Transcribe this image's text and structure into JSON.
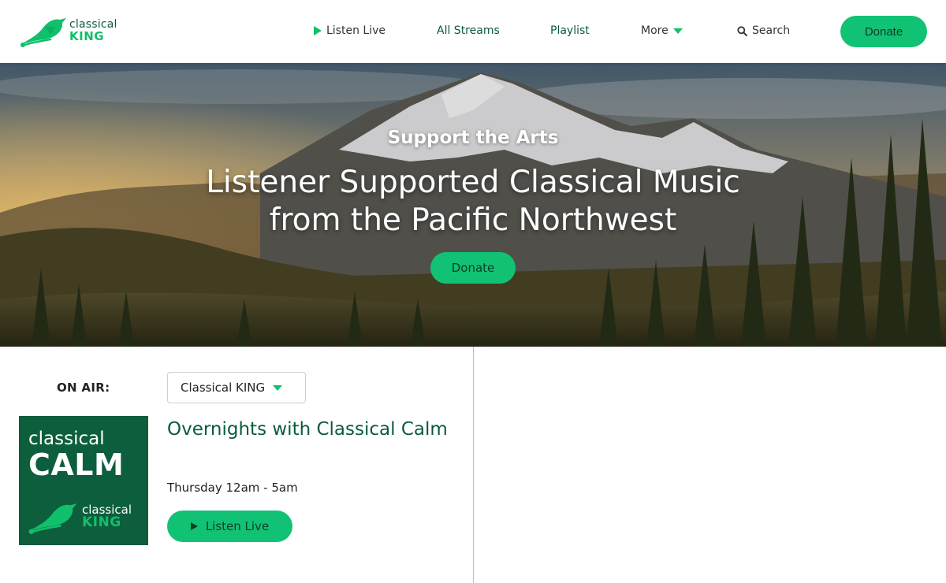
{
  "header": {
    "logo": {
      "line1": "classical",
      "line2": "KING"
    },
    "nav": {
      "listen_live": "Listen Live",
      "all_streams": "All Streams",
      "playlist": "Playlist",
      "more": "More",
      "search": "Search"
    },
    "donate_label": "Donate"
  },
  "hero": {
    "kicker": "Support the Arts",
    "title": "Listener Supported Classical Music from the Pacific Northwest",
    "donate_label": "Donate"
  },
  "on_air": {
    "label": "ON AIR:",
    "station_selected": "Classical KING",
    "artwork": {
      "line1": "classical",
      "line2": "CALM",
      "brand1": "classical",
      "brand2": "KING"
    },
    "show_title": "Overnights with Classical Calm",
    "schedule": "Thursday 12am - 5am",
    "listen_label": "Listen Live"
  },
  "colors": {
    "brand_green": "#12c274",
    "dark_green": "#0b5c3a",
    "artwork_green": "#0d5e3c"
  },
  "icons": [
    "bird-logo-icon",
    "play-icon",
    "caret-down-icon",
    "search-icon"
  ]
}
